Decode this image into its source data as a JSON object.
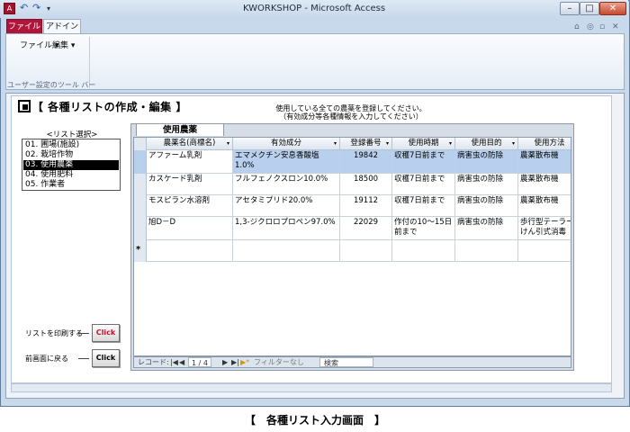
{
  "window": {
    "title": "KWORKSHOP - Microsoft Access"
  },
  "ribbon": {
    "tabs": [
      "ファイル",
      "アドイン"
    ],
    "menu_file": "ファイル ▾",
    "menu_edit": "編集 ▾",
    "group_label": "ユーザー設定のツール バー"
  },
  "form": {
    "header": "【 各種リストの作成・編集 】",
    "instruction_line1": "使用している全ての農薬を登録してください。",
    "instruction_line2": "（有効成分等各種情報を入力してください）",
    "list_label": "<リスト選択>",
    "list_items": [
      "01. 圃場(施設)",
      "02. 栽培作物",
      "03. 使用農薬",
      "04. 使用肥料",
      "05. 作業者"
    ],
    "selected_index": 2,
    "print_label": "リストを印刷する",
    "back_label": "前画面に戻る",
    "print_button": "Click",
    "back_button": "Click"
  },
  "subform": {
    "tab_label": "使用農薬",
    "columns": [
      "農薬名(商標名)",
      "有効成分",
      "登録番号",
      "使用時期",
      "使用目的",
      "使用方法"
    ],
    "rows": [
      [
        "アファーム乳剤",
        "エマメクチン安息香酸塩1.0%",
        "19842",
        "収穫7日前まで",
        "病害虫の防除",
        "農薬散布機"
      ],
      [
        "カスケード乳剤",
        "フルフェノクスロン10.0%",
        "18500",
        "収穫7日前まで",
        "病害虫の防除",
        "農薬散布機"
      ],
      [
        "モスピラン水溶剤",
        "アセタミプリド20.0%",
        "19112",
        "収穫7日前まで",
        "病害虫の防除",
        "農薬散布機"
      ],
      [
        "旭D－D",
        "1,3-ジクロロプロペン97.0%",
        "22029",
        "作付の10～15日前まで",
        "病害虫の防除",
        "歩行型テーラーけん引式消毒"
      ]
    ],
    "new_row_marker": "*"
  },
  "navigation": {
    "label": "レコード:",
    "first": "|◀",
    "prev": "◀",
    "position": "1 / 4",
    "next": "▶",
    "last": "▶|",
    "new": "▶*",
    "filter": "フィルターなし",
    "search": "検索"
  },
  "caption": "【　各種リスト入力画面　】",
  "colors": {
    "accent_file_tab": "#b2153a",
    "selected_row": "#b8d0ee",
    "print_button_text": "#c4122e"
  }
}
